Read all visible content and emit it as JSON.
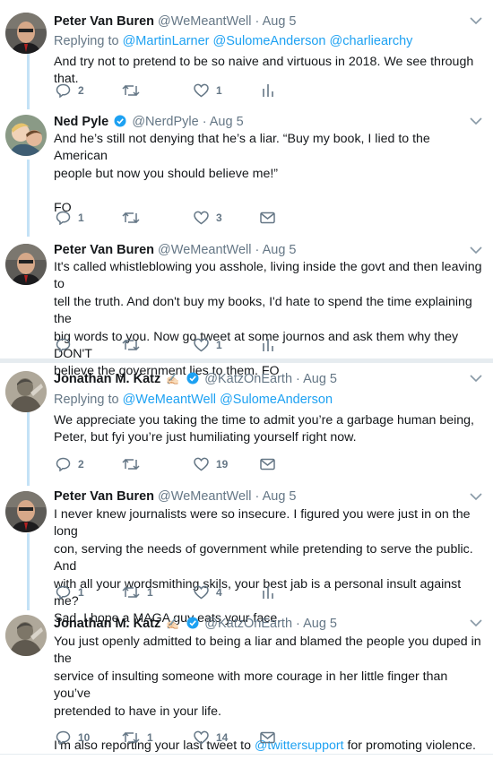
{
  "tweets": [
    {
      "name": "Peter Van Buren",
      "handle": "@WeMeantWell",
      "time": "· Aug 5",
      "replying_prefix": "Replying to",
      "replying_to": [
        "@MartinLarner",
        "@SulomeAnderson",
        "@charliearchy"
      ],
      "text": "And try not to pretend to be so naive and virtuous in 2018. We see through that.",
      "reply_count": "2",
      "retweet_count": "",
      "like_count": "1",
      "last_action_icon": "analytics-icon"
    },
    {
      "name": "Ned Pyle",
      "handle": "@NerdPyle",
      "time": "· Aug 5",
      "text_lines": [
        "And he’s still not denying that he’s a liar. “Buy my book, I lied to the American",
        "people but now you should believe me!”"
      ],
      "text2": "FO",
      "reply_count": "1",
      "retweet_count": "",
      "like_count": "3",
      "last_action_icon": "message-icon"
    },
    {
      "name": "Peter Van Buren",
      "handle": "@WeMeantWell",
      "time": "· Aug 5",
      "text_lines": [
        "It's called whistleblowing you asshole, living inside the govt and then leaving to",
        "tell the truth. And don't buy my books, I'd hate to spend the time explaining the",
        "big words to you. Now go tweet at some journos and ask them why they DON'T",
        "believe the government lies to them. FO"
      ],
      "reply_count": "",
      "retweet_count": "",
      "like_count": "1",
      "last_action_icon": "analytics-icon"
    },
    {
      "name": "Jonathan M. Katz",
      "quill": "✍🏻",
      "handle": "@KatzOnEarth",
      "time": "· Aug 5",
      "replying_prefix": "Replying to",
      "replying_to": [
        "@WeMeantWell",
        "@SulomeAnderson"
      ],
      "text_lines": [
        "We appreciate you taking the time to admit you’re a garbage human being,",
        "Peter, but fyi you’re just humiliating yourself right now."
      ],
      "reply_count": "2",
      "retweet_count": "",
      "like_count": "19",
      "last_action_icon": "message-icon"
    },
    {
      "name": "Peter Van Buren",
      "handle": "@WeMeantWell",
      "time": "· Aug 5",
      "text_lines": [
        "I never knew journalists were so insecure. I figured you were just in on the long",
        "con, serving the needs of government while pretending to serve the public. And",
        "with all your wordsmithing skils, your best jab is a personal insult against me?",
        "Sad. I hope a MAGA guy eats your face."
      ],
      "reply_count": "1",
      "retweet_count": "1",
      "like_count": "4",
      "last_action_icon": "analytics-icon"
    },
    {
      "name": "Jonathan M. Katz",
      "quill": "✍🏻",
      "handle": "@KatzOnEarth",
      "time": "· Aug 5",
      "text_lines": [
        "You just openly admitted to being a liar and blamed the people you duped in the",
        "service of insulting someone with more courage in her little finger than you’ve",
        "pretended to have in your life."
      ],
      "text2_prefix": "I’m also reporting your last tweet to ",
      "text2_link": "@twittersupport",
      "text2_suffix": " for promoting violence.",
      "reply_count": "10",
      "retweet_count": "1",
      "like_count": "14",
      "last_action_icon": "message-icon"
    }
  ],
  "colors": {
    "accent": "#1da1f2",
    "muted": "#657786",
    "thread": "#c4e2f6",
    "divider": "#e6ecf0"
  }
}
